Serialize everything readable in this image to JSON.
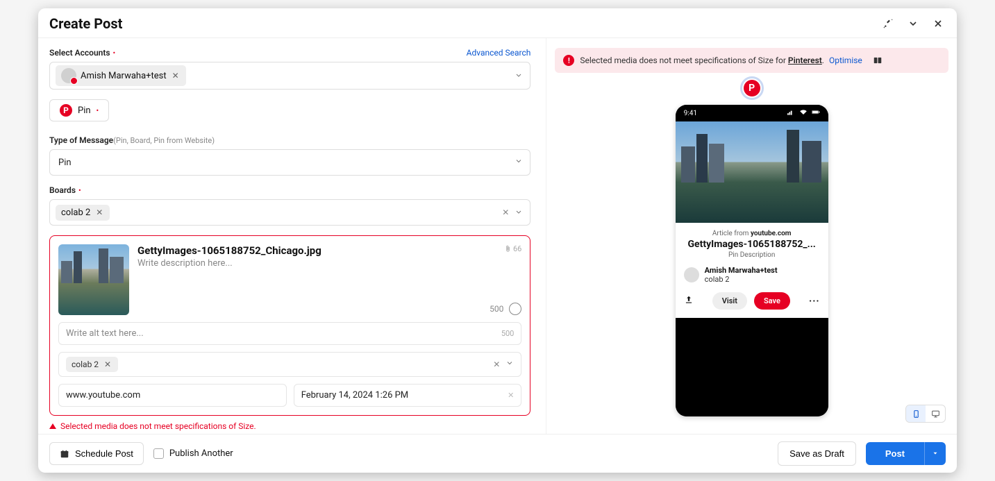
{
  "header": {
    "title": "Create Post"
  },
  "accounts": {
    "label": "Select Accounts",
    "advanced": "Advanced Search",
    "chip_name": "Amish Marwaha+test"
  },
  "network_tab": {
    "label": "Pin"
  },
  "type": {
    "label": "Type of Message",
    "hint": "(Pin, Board, Pin from Website)",
    "value": "Pin"
  },
  "boards": {
    "label": "Boards",
    "chip": "colab 2"
  },
  "media": {
    "filename": "GettyImages-1065188752_Chicago.jpg",
    "desc_placeholder": "Write description here...",
    "attach_count": "66",
    "desc_counter": "500",
    "alt_placeholder": "Write alt text here...",
    "alt_counter": "500",
    "board_chip": "colab 2",
    "url": "www.youtube.com",
    "datetime": "February 14, 2024 1:26 PM"
  },
  "error_line": "Selected media does not meet specifications of Size.",
  "alert": {
    "text_pre": "Selected media does not meet specifications of Size for ",
    "platform": "Pinterest",
    "period": ".",
    "optimise": "Optimise"
  },
  "preview": {
    "time": "9:41",
    "article_from_pre": "Article from ",
    "article_from_domain": "youtube.com",
    "title": "GettyImages-1065188752_...",
    "desc": "Pin Description",
    "user": "Amish Marwaha+test",
    "board": "colab 2",
    "visit": "Visit",
    "save": "Save"
  },
  "footer": {
    "schedule": "Schedule Post",
    "publish_another": "Publish Another",
    "save_draft": "Save as Draft",
    "post": "Post"
  }
}
